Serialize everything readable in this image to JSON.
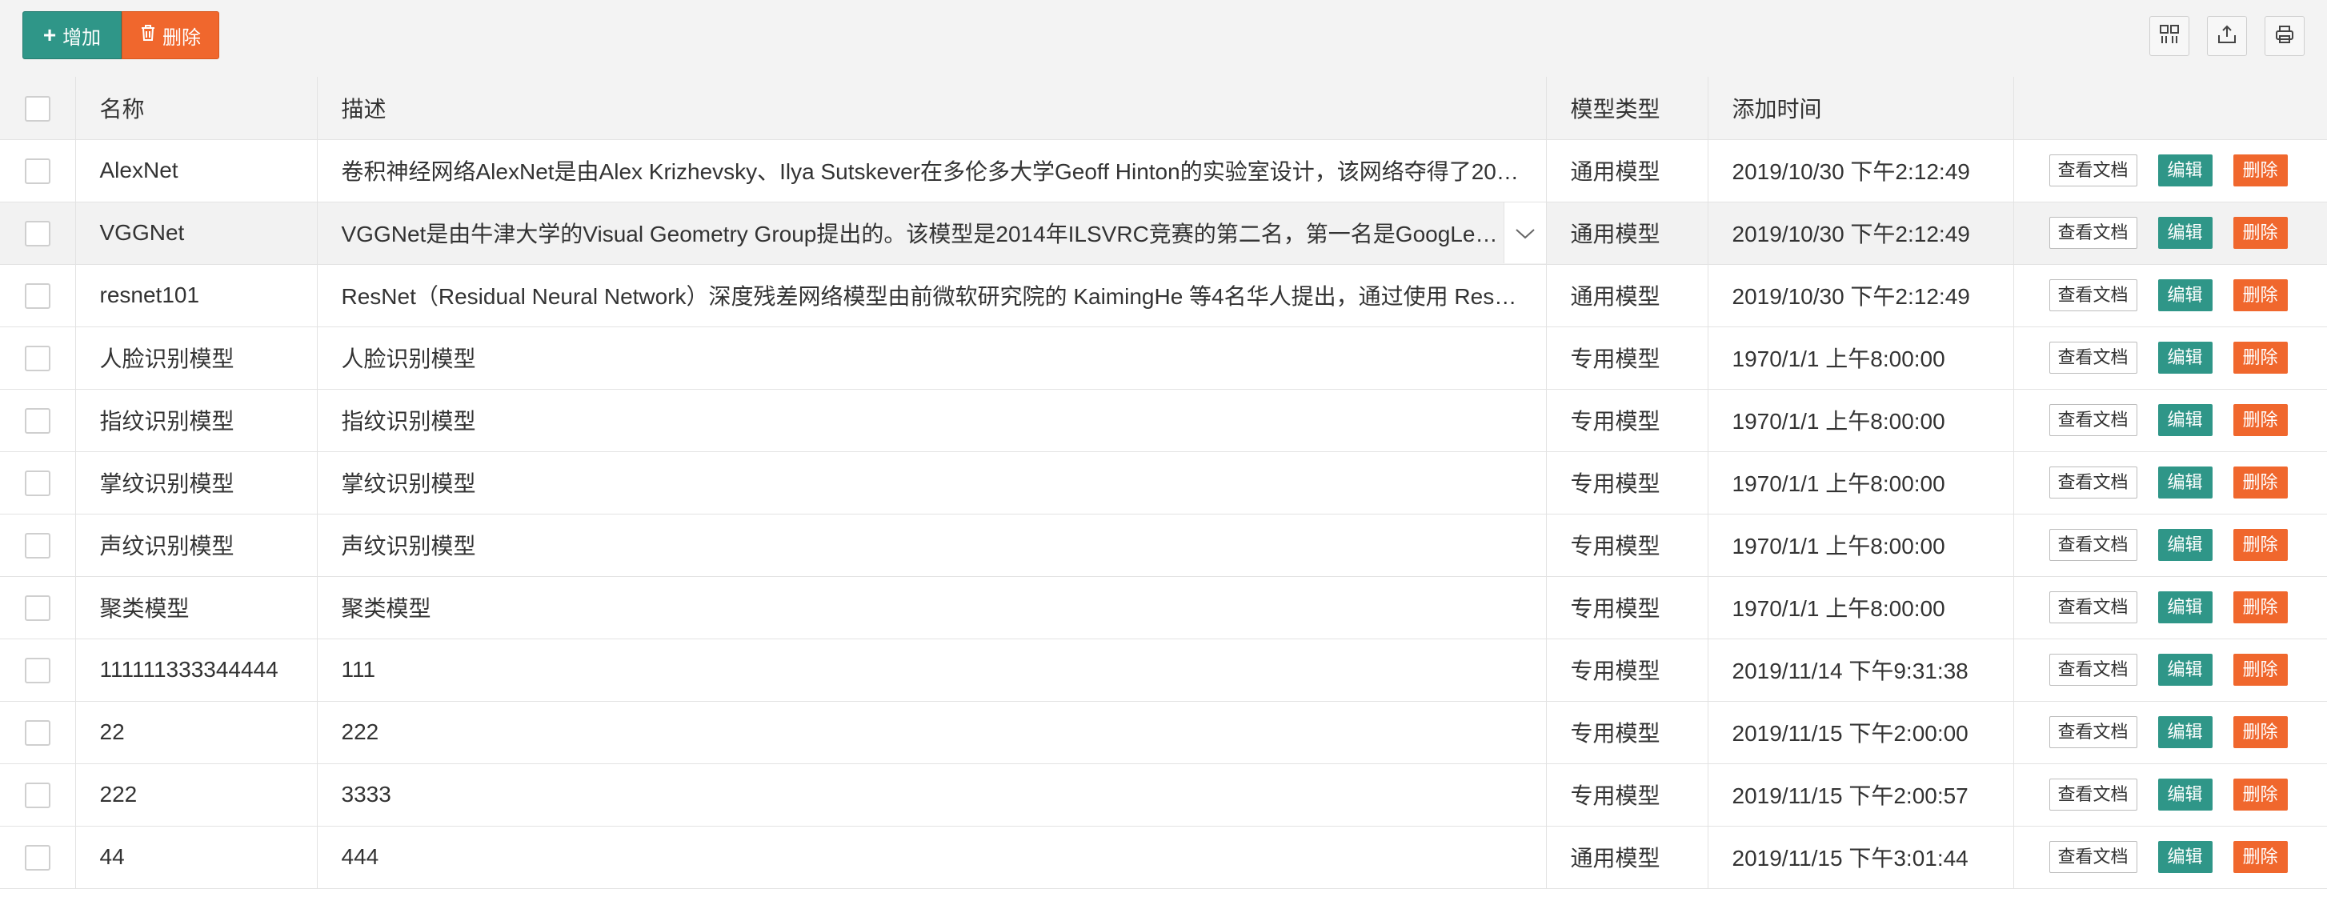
{
  "toolbar": {
    "add_label": "增加",
    "delete_label": "删除",
    "add_icon": "plus-icon",
    "delete_icon": "trash-icon",
    "right_icons": [
      "columns-icon",
      "export-icon",
      "print-icon"
    ]
  },
  "table": {
    "headers": {
      "name": "名称",
      "desc": "描述",
      "type": "模型类型",
      "time": "添加时间",
      "ops": ""
    },
    "actions": {
      "view_doc": "查看文档",
      "edit": "编辑",
      "delete": "删除"
    },
    "rows": [
      {
        "name": "AlexNet",
        "desc": "卷积神经网络AlexNet是由Alex Krizhevsky、Ilya Sutskever在多伦多大学Geoff Hinton的实验室设计，该网络夺得了20…",
        "type": "通用模型",
        "time": "2019/10/30 下午2:12:49"
      },
      {
        "name": "VGGNet",
        "desc": "VGGNet是由牛津大学的Visual Geometry Group提出的。该模型是2014年ILSVRC竞赛的第二名，第一名是GoogLeN…",
        "type": "通用模型",
        "time": "2019/10/30 下午2:12:49"
      },
      {
        "name": "resnet101",
        "desc": "ResNet（Residual Neural Network）深度残差网络模型由前微软研究院的 KaimingHe 等4名华人提出，通过使用 Res…",
        "type": "通用模型",
        "time": "2019/10/30 下午2:12:49"
      },
      {
        "name": "人脸识别模型",
        "desc": "人脸识别模型",
        "type": "专用模型",
        "time": "1970/1/1 上午8:00:00"
      },
      {
        "name": "指纹识别模型",
        "desc": "指纹识别模型",
        "type": "专用模型",
        "time": "1970/1/1 上午8:00:00"
      },
      {
        "name": "掌纹识别模型",
        "desc": "掌纹识别模型",
        "type": "专用模型",
        "time": "1970/1/1 上午8:00:00"
      },
      {
        "name": "声纹识别模型",
        "desc": "声纹识别模型",
        "type": "专用模型",
        "time": "1970/1/1 上午8:00:00"
      },
      {
        "name": "聚类模型",
        "desc": "聚类模型",
        "type": "专用模型",
        "time": "1970/1/1 上午8:00:00"
      },
      {
        "name": "111111333344444",
        "desc": "111",
        "type": "专用模型",
        "time": "2019/11/14 下午9:31:38"
      },
      {
        "name": "22",
        "desc": "222",
        "type": "专用模型",
        "time": "2019/11/15 下午2:00:00"
      },
      {
        "name": "222",
        "desc": "3333",
        "type": "专用模型",
        "time": "2019/11/15 下午2:00:57"
      },
      {
        "name": "44",
        "desc": "444",
        "type": "通用模型",
        "time": "2019/11/15 下午3:01:44"
      }
    ]
  },
  "colors": {
    "primary": "#2f9688",
    "danger": "#f0672d",
    "header_bg": "#f3f3f3",
    "border": "#e3e3e3",
    "hover_row": "#f2f2f2"
  }
}
